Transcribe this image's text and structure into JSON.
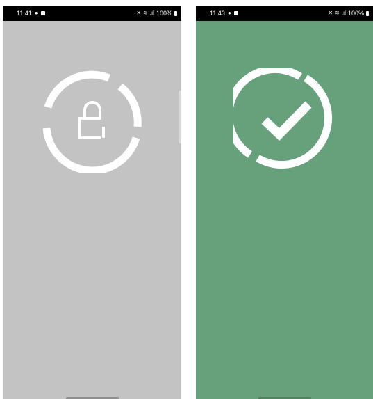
{
  "screens": [
    {
      "id": "locked",
      "status_bar": {
        "time": "11:41",
        "battery": "100%"
      },
      "background_color": "#c3c3c3",
      "icon": "padlock-icon",
      "ring_icon": "broken-ring-icon"
    },
    {
      "id": "unlocked",
      "status_bar": {
        "time": "11:43",
        "battery": "100%"
      },
      "background_color": "#66a17b",
      "icon": "checkmark-icon",
      "ring_icon": "broken-ring-icon"
    }
  ],
  "colors": {
    "foreground": "#ffffff",
    "status_bar": "#000000"
  }
}
